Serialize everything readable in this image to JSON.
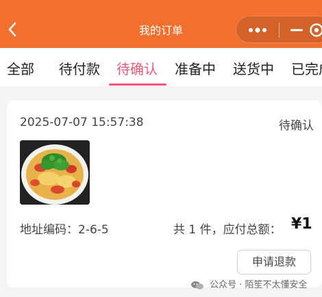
{
  "header": {
    "title": "我的订单",
    "back_icon": "chevron-left-icon",
    "menu_icons": [
      "more-dots-icon",
      "minimize-icon",
      "close-target-icon"
    ],
    "bg_color": "#f26f2e"
  },
  "tabs": {
    "items": [
      "全部",
      "待付款",
      "待确认",
      "准备中",
      "送货中",
      "已完成"
    ],
    "active_index": 2,
    "active_color": "#f0557a"
  },
  "order": {
    "time": "2025-07-07 15:57:38",
    "status": "待确认",
    "address": "地址编码：2-6-5",
    "total_label": "共 1 件，应付总额：",
    "total_value": "¥1",
    "refund_button": "申请退款"
  },
  "watermark": {
    "text": "公众号 · 陌笙不太懂安全"
  }
}
